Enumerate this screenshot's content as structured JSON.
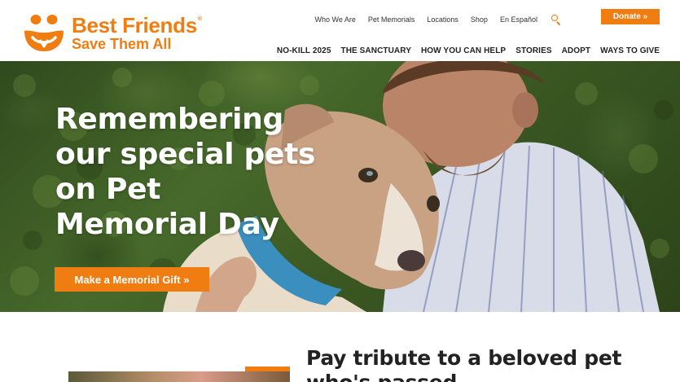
{
  "brand": {
    "name_line1": "Best Friends",
    "name_line2": "Save Them All",
    "registered": "®",
    "color_primary": "#f07d12"
  },
  "utility_nav": {
    "items": [
      "Who We Are",
      "Pet Memorials",
      "Locations",
      "Shop",
      "En Español"
    ],
    "search_icon": "search-icon"
  },
  "donate": {
    "label": "Donate »"
  },
  "main_nav": {
    "items": [
      "NO-KILL 2025",
      "THE SANCTUARY",
      "HOW YOU CAN HELP",
      "STORIES",
      "ADOPT",
      "WAYS TO GIVE"
    ]
  },
  "hero": {
    "title": "Remembering our special pets on Pet Memorial Day",
    "cta_label": "Make a Memorial Gift »"
  },
  "tribute": {
    "title": "Pay tribute to a beloved pet who's passed"
  }
}
